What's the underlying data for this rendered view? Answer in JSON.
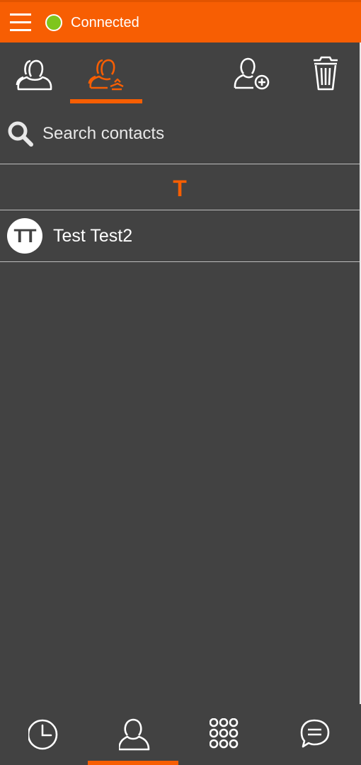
{
  "status": {
    "text": "Connected",
    "color": "#7fc51c"
  },
  "colors": {
    "accent": "#f75e03",
    "background": "#424242"
  },
  "tabs": [
    {
      "icon": "contacts-icon",
      "active": false
    },
    {
      "icon": "favorite-contacts-icon",
      "active": true
    },
    {
      "icon": "add-contact-icon",
      "active": false
    },
    {
      "icon": "trash-icon",
      "active": false
    }
  ],
  "search": {
    "placeholder": "Search contacts",
    "value": ""
  },
  "contacts": {
    "section_letter": "T",
    "items": [
      {
        "initials": "TT",
        "name": "Test Test2"
      }
    ]
  },
  "bottom_nav": [
    {
      "icon": "clock-icon",
      "active": false
    },
    {
      "icon": "contact-icon",
      "active": true
    },
    {
      "icon": "dialpad-icon",
      "active": false
    },
    {
      "icon": "chat-icon",
      "active": false
    }
  ]
}
